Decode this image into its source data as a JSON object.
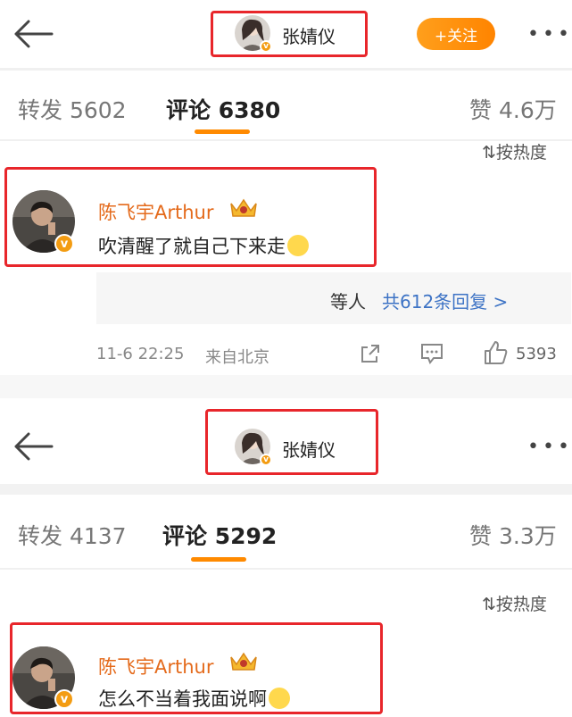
{
  "top": {
    "header": {
      "name": "张婧仪",
      "follow_label": "+关注",
      "more": "•••"
    },
    "tabs": [
      {
        "label": "转发",
        "count": "5602"
      },
      {
        "label": "评论",
        "count": "6380"
      },
      {
        "label": "赞",
        "count": "4.6万"
      }
    ],
    "sort_label": "按热度",
    "comment": {
      "username": "陈飞宇Arthur",
      "text": "吹清醒了就自己下来走",
      "replies_prefix": "等人",
      "replies_link": "共612条回复 >",
      "time": "11-6 22:25",
      "source": "来自北京",
      "likes": "5393"
    }
  },
  "bottom": {
    "header": {
      "name": "张婧仪",
      "more": "•••"
    },
    "tabs": [
      {
        "label": "转发",
        "count": "4137"
      },
      {
        "label": "评论",
        "count": "5292"
      },
      {
        "label": "赞",
        "count": "3.3万"
      }
    ],
    "sort_label": "按热度",
    "comment": {
      "username": "陈飞宇Arthur",
      "text": "怎么不当着我面说啊"
    }
  },
  "colors": {
    "accent": "#ff8a00",
    "highlight_box": "#e8262b",
    "username": "#e46a1b"
  }
}
